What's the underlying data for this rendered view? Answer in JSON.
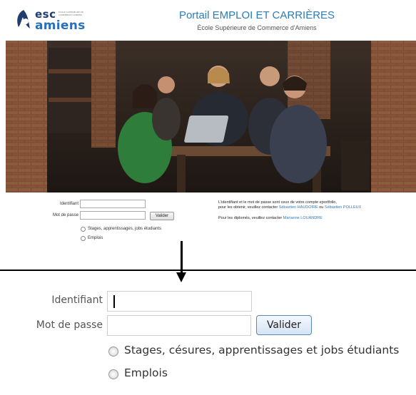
{
  "header": {
    "logo_esc": "esc",
    "logo_tagline": "ÉCOLE SUPÉRIEURE DE COMMERCE D'AMIENS",
    "logo_amiens": "amiens",
    "title": "Portail EMPLOI ET CARRIÈRES",
    "subtitle": "École Supérieure de Commerce d'Amiens"
  },
  "login": {
    "identifiant_label": "Identifiant",
    "identifiant_value": "",
    "password_label": "Mot de passe",
    "password_value": "",
    "submit_label": "Valider",
    "options": [
      {
        "label": "Stages, apprentissages, jobs étudiants",
        "selected": false
      },
      {
        "label": "Emplois",
        "selected": false
      }
    ]
  },
  "info": {
    "line1": "L'identifiant et le mot de passe sont ceux de votre compte eportfolio,",
    "line2_prefix": "pour les obtenir, veuillez contacter ",
    "contact1": "Sébastien HAUDOIRE",
    "line2_mid": " ou ",
    "contact2": "Sébastien POLLEUX",
    "line3_prefix": "Pour les diplomés, veuillez contacter ",
    "contact3": "Marianne LOUANDRE"
  },
  "zoom": {
    "identifiant_label": "Identifiant",
    "password_label": "Mot de passe",
    "submit_label": "Valider",
    "options": [
      {
        "label": "Stages, césures, apprentissages et jobs étudiants",
        "selected": false
      },
      {
        "label": "Emplois",
        "selected": false
      }
    ]
  }
}
